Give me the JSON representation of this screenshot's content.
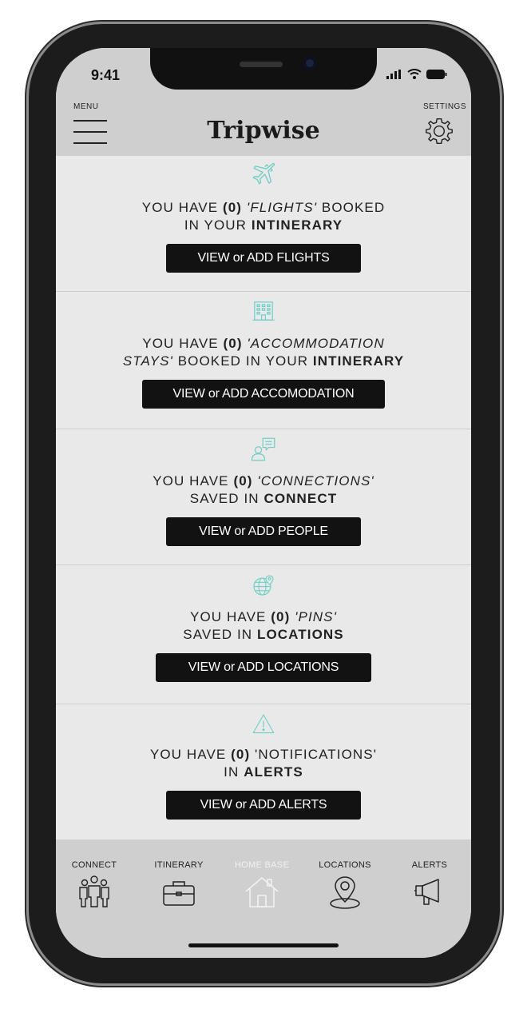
{
  "status_bar": {
    "time": "9:41"
  },
  "header": {
    "menu_label": "MENU",
    "title": "Tripwise",
    "settings_label": "SETTINGS"
  },
  "sections": [
    {
      "icon": "airplane-icon",
      "line1_prefix": "YOU HAVE ",
      "count": "(0)",
      "item": "'FLIGHTS'",
      "line1_suffix": " BOOKED",
      "line2_prefix": "IN YOUR ",
      "line2_bold": "INTINERARY",
      "button": "VIEW or ADD FLIGHTS"
    },
    {
      "icon": "hotel-building-icon",
      "line1_prefix": "YOU HAVE ",
      "count": "(0)",
      "item_part1": "'ACCOMMODATION",
      "item_part2": "STAYS'",
      "line2_suffix": " BOOKED IN YOUR ",
      "line2_bold": "INTINERARY",
      "button": "VIEW or ADD ACCOMODATION"
    },
    {
      "icon": "person-chat-icon",
      "line1_prefix": "YOU HAVE ",
      "count": "(0)",
      "item": "'CONNECTIONS'",
      "line2_prefix": "SAVED IN ",
      "line2_bold": "CONNECT",
      "button": "VIEW or ADD PEOPLE"
    },
    {
      "icon": "globe-pin-icon",
      "line1_prefix": "YOU HAVE ",
      "count": "(0)",
      "item": "'PINS'",
      "line2_prefix": "SAVED IN ",
      "line2_bold": "LOCATIONS",
      "button": "VIEW or ADD LOCATIONS"
    },
    {
      "icon": "warning-triangle-icon",
      "line1_prefix": "YOU HAVE ",
      "count": "(0)",
      "item": " 'NOTIFICATIONS'",
      "line2_prefix": "IN ",
      "line2_bold": "ALERTS",
      "button": "VIEW or ADD ALERTS"
    }
  ],
  "bottom_nav": [
    {
      "label": "CONNECT",
      "icon": "people-group-icon"
    },
    {
      "label": "ITINERARY",
      "icon": "briefcase-icon"
    },
    {
      "label": "HOME BASE",
      "icon": "home-icon",
      "active": true
    },
    {
      "label": "LOCATIONS",
      "icon": "location-pin-icon"
    },
    {
      "label": "ALERTS",
      "icon": "megaphone-icon"
    }
  ],
  "colors": {
    "accent": "#6fcfc6",
    "header_bg": "#cfcfcf",
    "content_bg": "#e9e9e9",
    "button_bg": "#121212"
  }
}
